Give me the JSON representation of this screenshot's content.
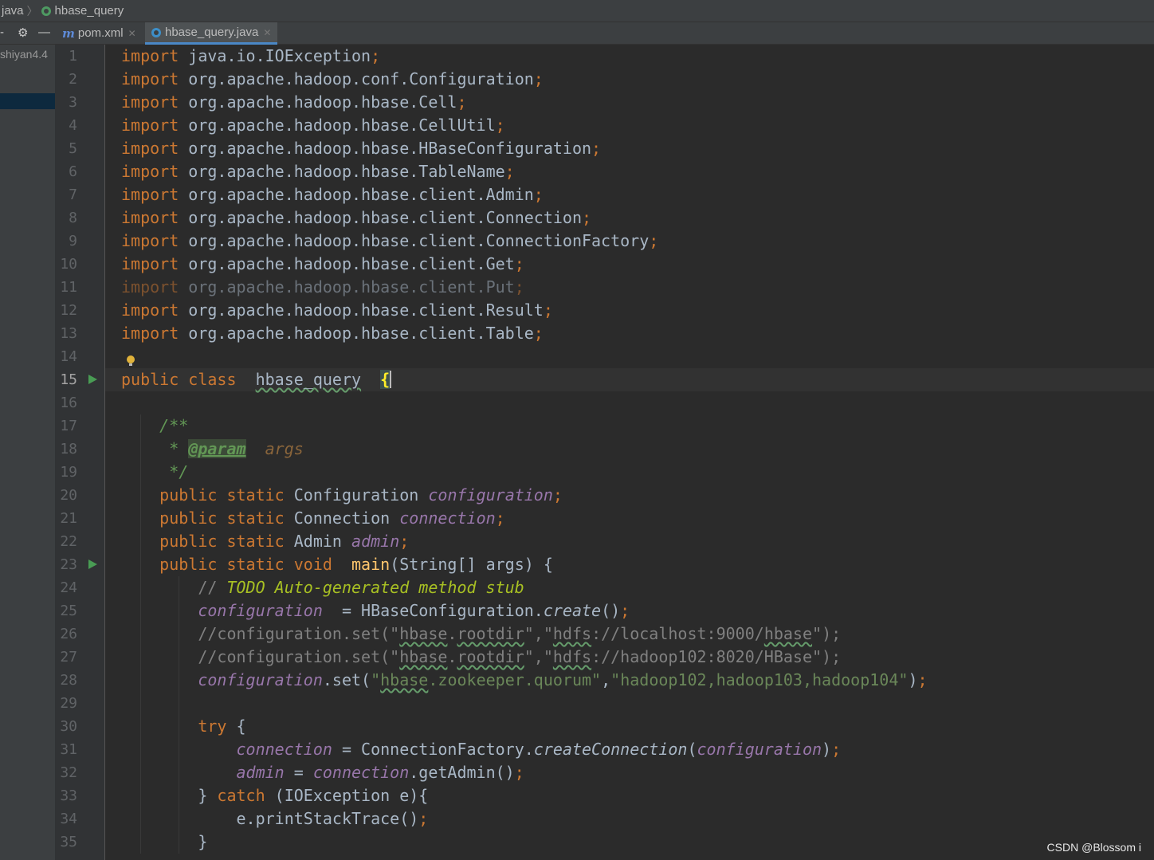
{
  "breadcrumb": {
    "folder": "java",
    "file": "hbase_query"
  },
  "tabs": [
    {
      "label": "pom.xml",
      "active": false
    },
    {
      "label": "hbase_query.java",
      "active": true
    }
  ],
  "project_panel": {
    "item": "shiyan4.4"
  },
  "current_line": 15,
  "lines": [
    [
      [
        "kw",
        "import"
      ],
      [
        "",
        "java.io.IOException"
      ],
      [
        "sc",
        ";"
      ]
    ],
    [
      [
        "kw",
        "import"
      ],
      [
        "",
        "org.apache.hadoop.conf.Configuration"
      ],
      [
        "sc",
        ";"
      ]
    ],
    [
      [
        "kw",
        "import"
      ],
      [
        "",
        "org.apache.hadoop.hbase.Cell"
      ],
      [
        "sc",
        ";"
      ]
    ],
    [
      [
        "kw",
        "import"
      ],
      [
        "",
        "org.apache.hadoop.hbase.CellUtil"
      ],
      [
        "sc",
        ";"
      ]
    ],
    [
      [
        "kw",
        "import"
      ],
      [
        "",
        "org.apache.hadoop.hbase.HBaseConfiguration"
      ],
      [
        "sc",
        ";"
      ]
    ],
    [
      [
        "kw",
        "import"
      ],
      [
        "",
        "org.apache.hadoop.hbase.TableName"
      ],
      [
        "sc",
        ";"
      ]
    ],
    [
      [
        "kw",
        "import"
      ],
      [
        "",
        "org.apache.hadoop.hbase.client.Admin"
      ],
      [
        "sc",
        ";"
      ]
    ],
    [
      [
        "kw",
        "import"
      ],
      [
        "",
        "org.apache.hadoop.hbase.client.Connection"
      ],
      [
        "sc",
        ";"
      ]
    ],
    [
      [
        "kw",
        "import"
      ],
      [
        "",
        "org.apache.hadoop.hbase.client.ConnectionFactory"
      ],
      [
        "sc",
        ";"
      ]
    ],
    [
      [
        "kw",
        "import"
      ],
      [
        "",
        "org.apache.hadoop.hbase.client.Get"
      ],
      [
        "sc",
        ";"
      ]
    ],
    [
      [
        "kw unused",
        "import"
      ],
      [
        "unused",
        "org.apache.hadoop.hbase.client.Put"
      ],
      [
        "sc unused",
        ";"
      ]
    ],
    [
      [
        "kw",
        "import"
      ],
      [
        "",
        "org.apache.hadoop.hbase.client.Result"
      ],
      [
        "sc",
        ";"
      ]
    ],
    [
      [
        "kw",
        "import"
      ],
      [
        "",
        "org.apache.hadoop.hbase.client.Table"
      ],
      [
        "sc",
        ";"
      ]
    ],
    [],
    [
      [
        "kw",
        "public class"
      ],
      [
        "",
        ""
      ],
      [
        "typo",
        "hbase_query"
      ],
      [
        "",
        ""
      ],
      [
        "brace",
        "{"
      ],
      [
        "cursor",
        ""
      ]
    ],
    [],
    [
      [
        "doc",
        "    /**"
      ]
    ],
    [
      [
        "doc",
        "     * "
      ],
      [
        "tag",
        "@param"
      ],
      [
        "doc",
        ""
      ],
      [
        "docp",
        "args"
      ]
    ],
    [
      [
        "doc",
        "     */"
      ]
    ],
    [
      [
        "",
        "    "
      ],
      [
        "kw",
        "public static"
      ],
      [
        "",
        "Configuration"
      ],
      [
        "st",
        "configuration"
      ],
      [
        "sc",
        ";"
      ]
    ],
    [
      [
        "",
        "    "
      ],
      [
        "kw",
        "public static"
      ],
      [
        "",
        "Connection"
      ],
      [
        "st",
        "connection"
      ],
      [
        "sc",
        ";"
      ]
    ],
    [
      [
        "",
        "    "
      ],
      [
        "kw",
        "public static"
      ],
      [
        "",
        "Admin"
      ],
      [
        "st",
        "admin"
      ],
      [
        "sc",
        ";"
      ]
    ],
    [
      [
        "",
        "    "
      ],
      [
        "kw",
        "public static void"
      ],
      [
        "",
        ""
      ],
      [
        "fn",
        "main"
      ],
      [
        "",
        "(String[] args) {"
      ]
    ],
    [
      [
        "cm",
        "        // "
      ],
      [
        "todo",
        "TODO Auto-generated method stub"
      ]
    ],
    [
      [
        "",
        "        "
      ],
      [
        "st",
        "configuration"
      ],
      [
        "",
        "  = HBaseConfiguration."
      ],
      [
        "sm",
        "create"
      ],
      [
        "",
        "()"
      ],
      [
        "sc",
        ";"
      ]
    ],
    [
      [
        "cm",
        "        //configuration.set(\""
      ],
      [
        "cm typo",
        "hbase"
      ],
      [
        "cm",
        "."
      ],
      [
        "cm typo",
        "rootdir"
      ],
      [
        "cm",
        "\",\""
      ],
      [
        "cm typo",
        "hdfs"
      ],
      [
        "cm",
        "://localhost:9000/"
      ],
      [
        "cm typo",
        "hbase"
      ],
      [
        "cm",
        "\");"
      ]
    ],
    [
      [
        "cm",
        "        //configuration.set(\""
      ],
      [
        "cm typo",
        "hbase"
      ],
      [
        "cm",
        "."
      ],
      [
        "cm typo",
        "rootdir"
      ],
      [
        "cm",
        "\",\""
      ],
      [
        "cm typo",
        "hdfs"
      ],
      [
        "cm",
        "://hadoop102:8020/HBase\");"
      ]
    ],
    [
      [
        "",
        "        "
      ],
      [
        "st",
        "configuration"
      ],
      [
        "",
        ".set("
      ],
      [
        "str",
        "\""
      ],
      [
        "str typo",
        "hbase"
      ],
      [
        "str",
        ".zookeeper.quorum\""
      ],
      [
        "",
        ","
      ],
      [
        "str",
        "\"hadoop102,hadoop103,hadoop104\""
      ],
      [
        "",
        ")"
      ],
      [
        "sc",
        ";"
      ]
    ],
    [],
    [
      [
        "",
        "        "
      ],
      [
        "kw",
        "try"
      ],
      [
        "",
        "{"
      ]
    ],
    [
      [
        "",
        "            "
      ],
      [
        "st",
        "connection"
      ],
      [
        "",
        " = ConnectionFactory."
      ],
      [
        "sm",
        "createConnection"
      ],
      [
        "",
        "("
      ],
      [
        "st",
        "configuration"
      ],
      [
        "",
        ")"
      ],
      [
        "sc",
        ";"
      ]
    ],
    [
      [
        "",
        "            "
      ],
      [
        "st",
        "admin"
      ],
      [
        "",
        " = "
      ],
      [
        "st",
        "connection"
      ],
      [
        "",
        ".getAdmin()"
      ],
      [
        "sc",
        ";"
      ]
    ],
    [
      [
        "",
        "        }"
      ],
      [
        "kw",
        "catch"
      ],
      [
        "",
        " (IOException e){"
      ]
    ],
    [
      [
        "",
        "            e.printStackTrace()"
      ],
      [
        "sc",
        ";"
      ]
    ],
    [
      [
        "",
        "        }"
      ]
    ]
  ],
  "run_lines": [
    15,
    23
  ],
  "fold_lines": [
    1,
    13,
    17,
    19,
    23,
    26,
    27,
    30,
    33,
    35
  ],
  "bulb_line": 14,
  "watermark": "CSDN @Blossom i",
  "colors": {
    "background": "#2b2b2b",
    "keyword": "#cc7832",
    "static_field": "#9876aa",
    "string": "#6a8759",
    "comment": "#808080",
    "doc_comment": "#629755",
    "method_decl": "#ffc66d",
    "todo": "#a8c023",
    "run_icon": "#499c54"
  }
}
